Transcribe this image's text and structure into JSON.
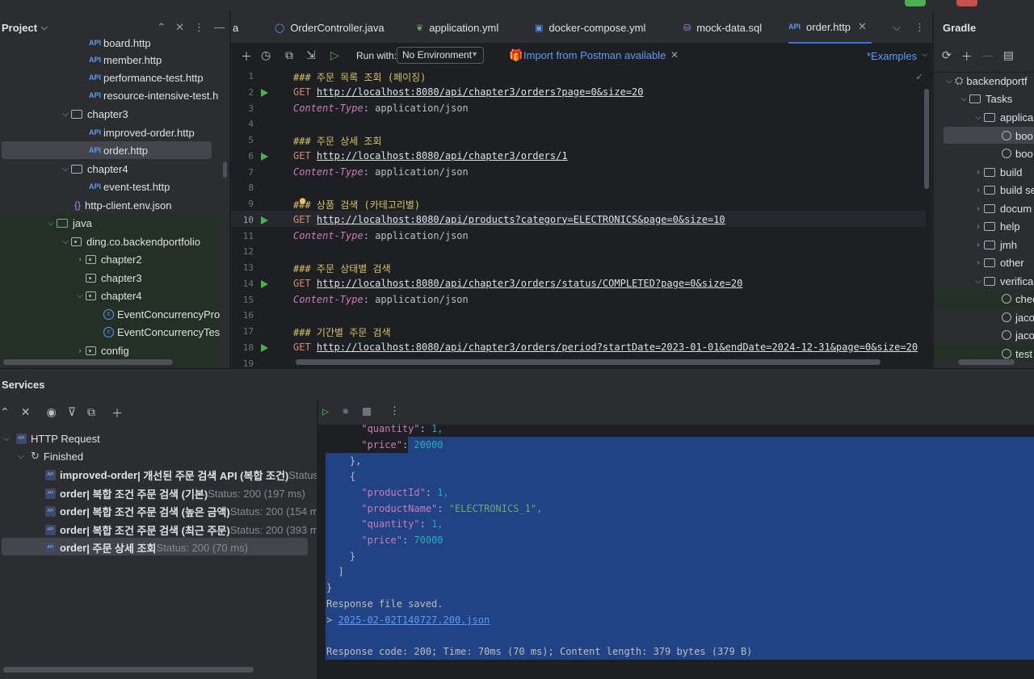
{
  "project": {
    "title": "Project",
    "items": [
      {
        "label": "board.http"
      },
      {
        "label": "member.http"
      },
      {
        "label": "performance-test.http"
      },
      {
        "label": "resource-intensive-test.h"
      },
      {
        "label": "chapter3"
      },
      {
        "label": "improved-order.http"
      },
      {
        "label": "order.http"
      },
      {
        "label": "chapter4"
      },
      {
        "label": "event-test.http"
      },
      {
        "label": "http-client.env.json"
      },
      {
        "label": "java"
      },
      {
        "label": "ding.co.backendportfolio"
      },
      {
        "label": "chapter2"
      },
      {
        "label": "chapter3"
      },
      {
        "label": "chapter4"
      },
      {
        "label": "EventConcurrencyPro"
      },
      {
        "label": "EventConcurrencyTes"
      },
      {
        "label": "config"
      }
    ]
  },
  "editor": {
    "tabs": [
      {
        "label": "a"
      },
      {
        "label": "OrderController.java"
      },
      {
        "label": "application.yml"
      },
      {
        "label": "docker-compose.yml"
      },
      {
        "label": "mock-data.sql"
      },
      {
        "label": "order.http"
      }
    ],
    "run_with_label": "Run with:",
    "environment": "No Environment",
    "import_label": "Import from Postman available",
    "examples_label": "*Examples",
    "current_line": 10,
    "line_numbers": [
      "1",
      "2",
      "3",
      "4",
      "5",
      "6",
      "7",
      "8",
      "9",
      "10",
      "11",
      "12",
      "13",
      "14",
      "15",
      "16",
      "17",
      "18",
      "19"
    ],
    "lines": [
      {
        "kind": "comment",
        "text": "### 주문 목록 조회 (페이징)"
      },
      {
        "kind": "get",
        "method": "GET",
        "url": "http://localhost:8080/api/chapter3/orders?page=0&size=20"
      },
      {
        "kind": "header",
        "name": "Content-Type",
        "value": ": application/json"
      },
      {
        "kind": "blank"
      },
      {
        "kind": "comment",
        "text": "### 주문 상세 조회"
      },
      {
        "kind": "get",
        "method": "GET",
        "url": "http://localhost:8080/api/chapter3/orders/1"
      },
      {
        "kind": "header",
        "name": "Content-Type",
        "value": ": application/json"
      },
      {
        "kind": "blank"
      },
      {
        "kind": "comment",
        "text": "### 상품 검색 (카테고리별)"
      },
      {
        "kind": "get",
        "method": "GET",
        "url": "http://localhost:8080/api/products?category=ELECTRONICS&page=0&size=10"
      },
      {
        "kind": "header",
        "name": "Content-Type",
        "value": ": application/json"
      },
      {
        "kind": "blank"
      },
      {
        "kind": "comment",
        "text": "### 주문 상태별 검색"
      },
      {
        "kind": "get",
        "method": "GET",
        "url": "http://localhost:8080/api/chapter3/orders/status/COMPLETED?page=0&size=20"
      },
      {
        "kind": "header",
        "name": "Content-Type",
        "value": ": application/json"
      },
      {
        "kind": "blank"
      },
      {
        "kind": "comment",
        "text": "### 기간별 주문 검색"
      },
      {
        "kind": "get",
        "method": "GET",
        "url": "http://localhost:8080/api/chapter3/orders/period?startDate=2023-01-01&endDate=2024-12-31&page=0&size=20"
      },
      {
        "kind": "blank"
      }
    ]
  },
  "gradle": {
    "title": "Gradle",
    "items": [
      {
        "label": "backendportf"
      },
      {
        "label": "Tasks"
      },
      {
        "label": "applica"
      },
      {
        "label": "boo"
      },
      {
        "label": "boo"
      },
      {
        "label": "build"
      },
      {
        "label": "build se"
      },
      {
        "label": "docum"
      },
      {
        "label": "help"
      },
      {
        "label": "jmh"
      },
      {
        "label": "other"
      },
      {
        "label": "verifica"
      },
      {
        "label": "chec"
      },
      {
        "label": "jaco"
      },
      {
        "label": "jaco"
      },
      {
        "label": "test"
      }
    ]
  },
  "services": {
    "title": "Services",
    "root_label": "HTTP Request",
    "finished_label": "Finished",
    "requests": [
      {
        "name": "improved-order",
        "desc": " | 개선된 주문 검색 API (복합 조건)",
        "status": " Status:"
      },
      {
        "name": "order",
        "desc": " | 복합 조건 주문 검색 (기본)",
        "status": " Status: 200 (197 ms)"
      },
      {
        "name": "order",
        "desc": " | 복합 조건 주문 검색 (높은 금액)",
        "status": " Status: 200 (154 ms"
      },
      {
        "name": "order",
        "desc": " | 복합 조건 주문 검색 (최근 주문)",
        "status": " Status: 200 (393 ms"
      },
      {
        "name": "order",
        "desc": " | 주문 상세 조회",
        "status": " Status: 200 (70 ms)"
      }
    ],
    "response": {
      "quantity_key": "\"quantity\"",
      "price_key": "\"price\"",
      "productId_key": "\"productId\"",
      "productName_key": "\"productName\"",
      "qty1": "1,",
      "price1": "20000",
      "productId": "1,",
      "productName": "\"ELECTRONICS_1\",",
      "qty2": "1,",
      "price2": "70000",
      "saved": "Response file saved.",
      "file_prefix": "> ",
      "file": "2025-02-02T140727.200.json",
      "summary": "Response code: 200; Time: 70ms (70 ms); Content length: 379 bytes (379 B)"
    }
  },
  "colors": {
    "accent": "#3574f0",
    "run_green": "#4caf50",
    "selection": "#214283"
  }
}
